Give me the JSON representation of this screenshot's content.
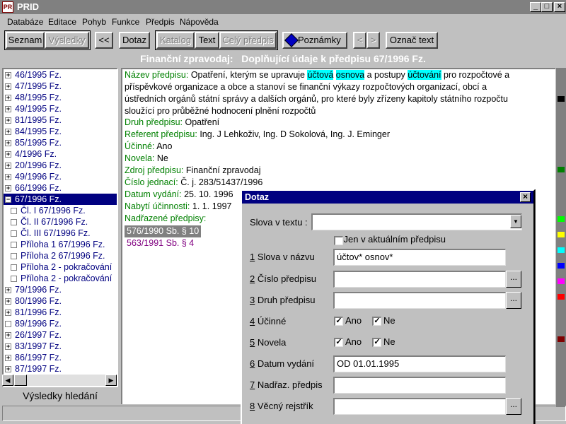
{
  "window": {
    "title": "PRID",
    "icon_text": "PR",
    "minimize": "_",
    "restore": "□",
    "close": "×"
  },
  "menu": [
    "Databáze",
    "Editace",
    "Pohyb",
    "Funkce",
    "Předpis",
    "Nápověda"
  ],
  "toolbar": {
    "seznam": "Seznam",
    "vysledky": "Výsledky",
    "back": "<<",
    "dotaz": "Dotaz",
    "katalog": "Katalog",
    "text": "Text",
    "cely_predpis": "Celý předpis",
    "poznamky": "Poznámky",
    "prev": "<",
    "next": ">",
    "oznac_text": "Označ text"
  },
  "header": {
    "source": "Finanční zpravodaj:",
    "title": "Doplňující údaje k předpisu 67/1996 Fz."
  },
  "tree": {
    "items": [
      "46/1995 Fz.",
      "47/1995 Fz.",
      "48/1995 Fz.",
      "49/1995 Fz.",
      "81/1995 Fz.",
      "84/1995 Fz.",
      "85/1995 Fz.",
      "4/1996 Fz.",
      "20/1996 Fz.",
      "49/1996 Fz.",
      "66/1996 Fz.",
      "67/1996 Fz."
    ],
    "children": [
      "Čl. I 67/1996 Fz.",
      "Čl. II 67/1996 Fz.",
      "Čl. III 67/1996 Fz.",
      "Příloha 1 67/1996 Fz.",
      "Příloha 2 67/1996 Fz.",
      "Příloha 2 - pokračování",
      "Příloha 2 - pokračování"
    ],
    "items_after": [
      "79/1996 Fz.",
      "80/1996 Fz.",
      "81/1996 Fz.",
      "89/1996 Fz.",
      "26/1997 Fz.",
      "83/1997 Fz.",
      "86/1997 Fz.",
      "87/1997 Fz."
    ],
    "vysledky_label": "Výsledky hledání"
  },
  "detail": {
    "nazev_label": "Název předpisu:",
    "nazev_parts": [
      "Opatření, kterým se upravuje ",
      "účtová",
      " ",
      "osnova",
      " a postupy ",
      "účtování",
      " pro rozpočtové a příspěvkové organizace a obce a stanoví se finanční výkazy rozpočtových organizací, obcí a ústředních orgánů státní správy a dalších orgánů, pro které byly zřízeny kapitoly státního rozpočtu sloužící pro průběžné hodnocení plnění rozpočtů"
    ],
    "druh_label": "Druh předpisu:",
    "druh": "Opatření",
    "referent_label": "Referent předpisu:",
    "referent": "Ing. J Lehkoživ, Ing. D Sokolová, Ing. J. Eminger",
    "ucinne_label": "Účinné:",
    "ucinne": "Ano",
    "novela_label": "Novela:",
    "novela": "Ne",
    "zdroj_label": "Zdroj předpisu:",
    "zdroj": "Finanční zpravodaj",
    "cislo_label": "Číslo jednací:",
    "cislo": "Č. j. 283/51437/1996",
    "datum_label": "Datum vydání:",
    "datum": "25. 10. 1996",
    "nabyti_label": "Nabytí účinnosti:",
    "nabyti": "1. 1. 1997",
    "nadrazene_label": "Nadřazené předpisy:",
    "nadrazene": [
      "576/1990 Sb. § 10",
      "563/1991 Sb. § 4"
    ]
  },
  "dialog": {
    "title": "Dotaz",
    "close": "×",
    "slova_label": "Slova v textu :",
    "jen_label": "Jen v aktuálním předpisu",
    "f1_num": "1",
    "f1_label": " Slova v názvu",
    "f1_value": "účtov* osnov*",
    "f2_num": "2",
    "f2_label": " Číslo předpisu",
    "f2_value": "",
    "f3_num": "3",
    "f3_label": " Druh předpisu",
    "f3_value": "",
    "f4_num": "4",
    "f4_label": " Účinné",
    "f5_num": "5",
    "f5_label": " Novela",
    "ano": "Ano",
    "ne": "Ne",
    "f6_num": "6",
    "f6_label": " Datum vydání",
    "f6_value": "OD 01.01.1995",
    "f7_num": "7",
    "f7_label": " Nadřaz. předpis",
    "f7_value": "",
    "f8_num": "8",
    "f8_label": " Věcný rejstřík",
    "f8_value": "",
    "ellipsis": "...",
    "check": "✓",
    "dropdown_arrow": "▼"
  },
  "colors": {
    "label_green": "#008000",
    "highlight": "#00ffff",
    "tree_link": "#000080",
    "dialog_title": "#000080",
    "parent_link": "#800080"
  }
}
